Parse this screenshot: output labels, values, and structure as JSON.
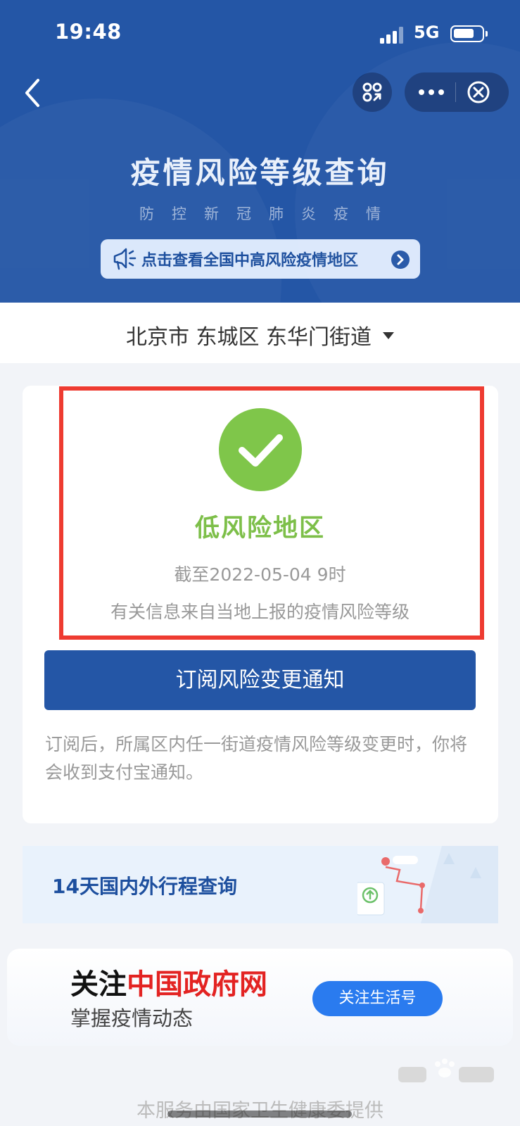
{
  "status_bar": {
    "time": "19:48",
    "network": "5G"
  },
  "header": {
    "title": "疫情风险等级查询",
    "subtitle": "防控新冠肺炎疫情",
    "risk_areas_link": "点击查看全国中高风险疫情地区"
  },
  "location": {
    "selected": "北京市 东城区 东华门街道"
  },
  "result": {
    "risk_level": "低风险地区",
    "as_of": "截至2022-05-04 9时",
    "source_note": "有关信息来自当地上报的疫情风险等级",
    "status_color": "#7fc64a"
  },
  "subscribe": {
    "button_label": "订阅风险变更通知",
    "note": "订阅后，所属区内任一街道疫情风险等级变更时，你将会收到支付宝通知。"
  },
  "trip_check": {
    "label": "14天国内外行程查询"
  },
  "follow": {
    "prefix": "关注",
    "brand": "中国政府网",
    "tagline": "掌握疫情动态",
    "button_label": "关注生活号"
  },
  "footer": {
    "note": "本服务由国家卫生健康委提供"
  },
  "colors": {
    "header_bg": "#2456a6",
    "alert_red": "#ee3b31",
    "brand_red": "#e32322",
    "button_blue": "#2a7bef"
  }
}
